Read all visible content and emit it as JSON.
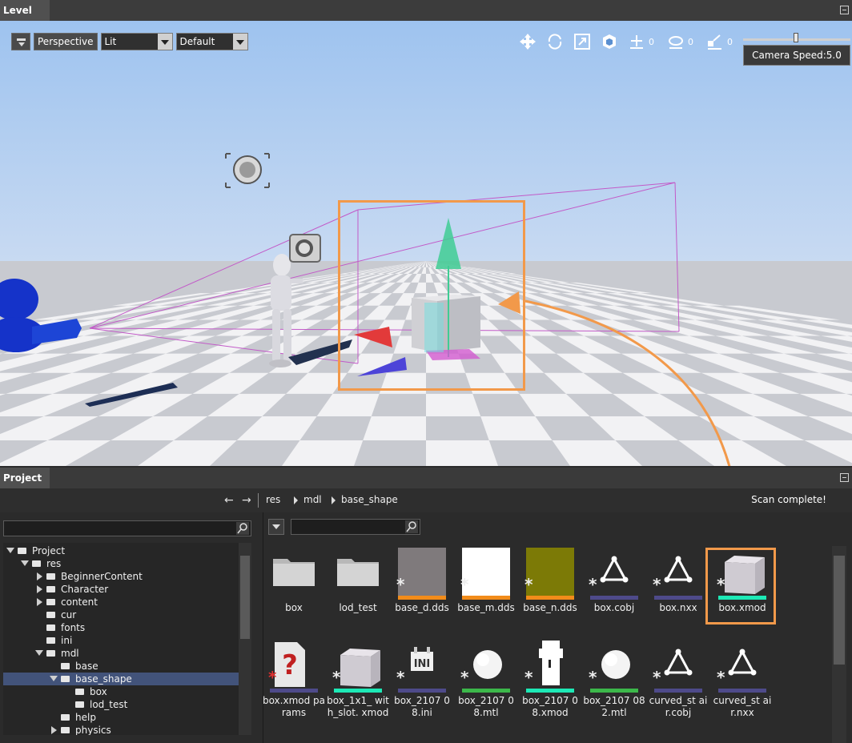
{
  "level_panel": {
    "tab": "Level"
  },
  "viewport": {
    "view_mode": "Perspective",
    "lighting": "Lit",
    "preset": "Default",
    "gizmo_counts": [
      "0",
      "0",
      "0"
    ],
    "camera_speed": "Camera Speed:5.0"
  },
  "project_panel": {
    "tab": "Project",
    "breadcrumb": [
      "res",
      "mdl",
      "base_shape"
    ],
    "status": "Scan complete!",
    "tree": [
      {
        "label": "Project",
        "depth": 0,
        "state": "open"
      },
      {
        "label": "res",
        "depth": 1,
        "state": "open"
      },
      {
        "label": "BeginnerContent",
        "depth": 2,
        "state": "closed"
      },
      {
        "label": "Character",
        "depth": 2,
        "state": "closed"
      },
      {
        "label": "content",
        "depth": 2,
        "state": "closed"
      },
      {
        "label": "cur",
        "depth": 2,
        "state": "none"
      },
      {
        "label": "fonts",
        "depth": 2,
        "state": "none"
      },
      {
        "label": "ini",
        "depth": 2,
        "state": "none"
      },
      {
        "label": "mdl",
        "depth": 2,
        "state": "open"
      },
      {
        "label": "base",
        "depth": 3,
        "state": "none"
      },
      {
        "label": "base_shape",
        "depth": 3,
        "state": "open",
        "selected": true
      },
      {
        "label": "box",
        "depth": 4,
        "state": "none"
      },
      {
        "label": "lod_test",
        "depth": 4,
        "state": "none"
      },
      {
        "label": "help",
        "depth": 3,
        "state": "none"
      },
      {
        "label": "physics",
        "depth": 3,
        "state": "closed"
      }
    ],
    "files": [
      {
        "name": "box",
        "kind": "folder",
        "bar": ""
      },
      {
        "name": "lod_test",
        "kind": "folder",
        "bar": ""
      },
      {
        "name": "base_d.dds",
        "kind": "swatch",
        "swatch": "#7f7a7c",
        "bar": "#f28c1a"
      },
      {
        "name": "base_m.dds",
        "kind": "swatch",
        "swatch": "#ffffff",
        "bar": "#f28c1a"
      },
      {
        "name": "base_n.dds",
        "kind": "swatch",
        "swatch": "#7c7a06",
        "bar": "#f28c1a"
      },
      {
        "name": "box.cobj",
        "kind": "triangle",
        "bar": "#4e4a8a"
      },
      {
        "name": "box.nxx",
        "kind": "triangle",
        "bar": "#4e4a8a"
      },
      {
        "name": "box.xmod",
        "kind": "cube",
        "bar": "#1de9b6"
      },
      {
        "name": "box.xmod params",
        "kind": "params",
        "bar": "#4e4a8a"
      },
      {
        "name": "box_1x1_ with_slot. xmod",
        "kind": "cube",
        "bar": "#1de9b6"
      },
      {
        "name": "box_2107 08.ini",
        "kind": "ini",
        "bar": "#4e4a8a"
      },
      {
        "name": "box_2107 08.mtl",
        "kind": "sphere",
        "bar": "#3cb84a"
      },
      {
        "name": "box_2107 08.xmod",
        "kind": "blob",
        "bar": "#1de9b6"
      },
      {
        "name": "box_2107 082.mtl",
        "kind": "sphere",
        "bar": "#3cb84a"
      },
      {
        "name": "curved_st air.cobj",
        "kind": "triangle",
        "bar": "#4e4a8a"
      },
      {
        "name": "curved_st air.nxx",
        "kind": "triangle",
        "bar": "#4e4a8a"
      }
    ],
    "highlighted_file": "box.xmod"
  },
  "colors": {
    "highlight": "#f2994a",
    "selection": "#42537a",
    "sky": "#a9c9f0",
    "floor_light": "#f2f2f4",
    "floor_dark": "#c5c7cd"
  }
}
